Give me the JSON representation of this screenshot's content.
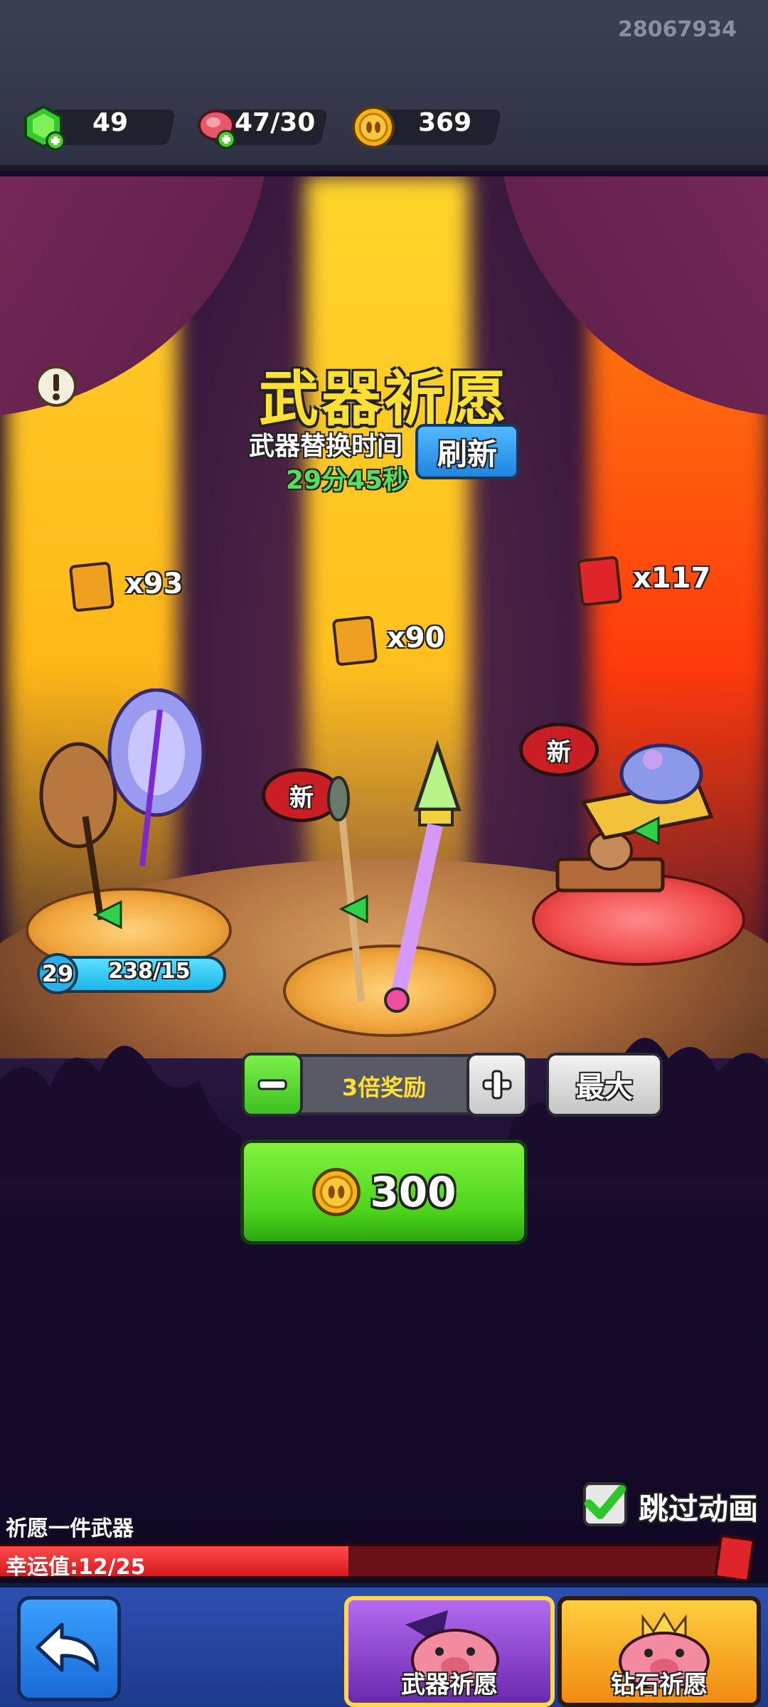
{
  "header": {
    "user_id": "28067934",
    "gems": "49",
    "meat": "47/30",
    "coins": "369"
  },
  "wish": {
    "title": "武器祈愿",
    "swap_time_label": "武器替换时间",
    "refresh_button": "刷新",
    "countdown": "29分45秒"
  },
  "weapons": [
    {
      "card_count": "x93",
      "card_color": "#f0a020",
      "level": "29",
      "progress": "238/15",
      "is_new": false
    },
    {
      "card_count": "x90",
      "card_color": "#f0a020",
      "is_new": true,
      "new_label": "新"
    },
    {
      "card_count": "x117",
      "card_color": "#e0252a",
      "is_new": true,
      "new_label": "新"
    }
  ],
  "multiplier": {
    "minus": "−",
    "label": "3倍奖励",
    "plus": "+",
    "max_button": "最大"
  },
  "cost": {
    "value": "300"
  },
  "skip": {
    "label": "跳过动画",
    "checked": true
  },
  "footer": {
    "wish_one": "祈愿一件武器",
    "luck_label": "幸运值:12/25",
    "luck_fraction": 0.48
  },
  "tabs": [
    {
      "label": "武器祈愿",
      "active": true
    },
    {
      "label": "钻石祈愿",
      "active": false
    }
  ],
  "colors": {
    "accent_green": "#5ee12b",
    "title_yellow": "#ffe033",
    "countdown_green": "#54e05a",
    "refresh_blue": "#2a9bf0",
    "luck_red": "#e01f26"
  }
}
